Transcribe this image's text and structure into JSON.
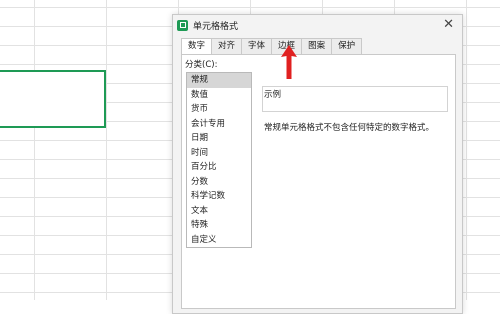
{
  "dialog": {
    "title": "单元格格式",
    "close_icon": "close-icon"
  },
  "tabs": [
    "数字",
    "对齐",
    "字体",
    "边框",
    "图案",
    "保护"
  ],
  "category": {
    "label": "分类(C):",
    "items": [
      "常规",
      "数值",
      "货币",
      "会计专用",
      "日期",
      "时间",
      "百分比",
      "分数",
      "科学记数",
      "文本",
      "特殊",
      "自定义"
    ],
    "selected": "常规"
  },
  "sample": {
    "label": "示例"
  },
  "description": "常规单元格格式不包含任何特定的数字格式。",
  "colors": {
    "accent": "#1e9a55",
    "annotation_arrow": "#e02020"
  }
}
